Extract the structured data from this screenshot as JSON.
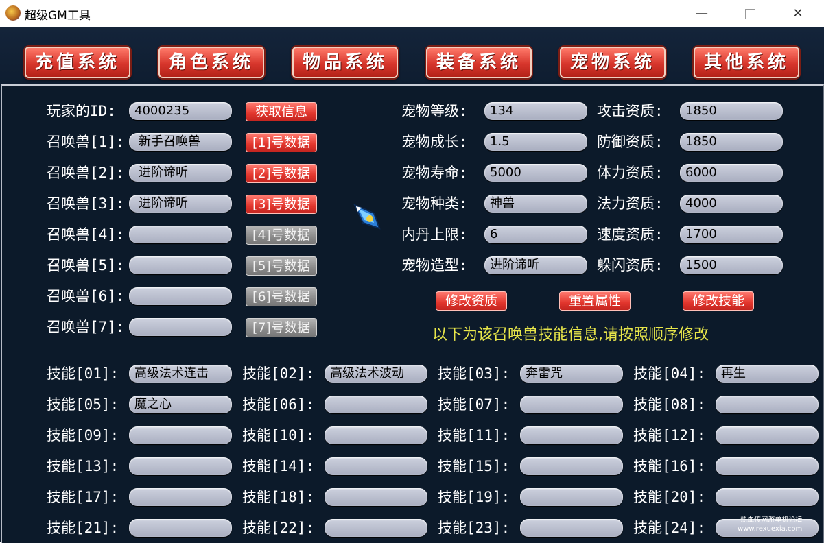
{
  "window": {
    "title": "超级GM工具",
    "minimize": "—",
    "close": "✕"
  },
  "nav": [
    "充值系统",
    "角色系统",
    "物品系统",
    "装备系统",
    "宠物系统",
    "其他系统"
  ],
  "player": {
    "label": "玩家的ID:",
    "value": "4000235",
    "fetch_button": "获取信息"
  },
  "summons": [
    {
      "label": "召唤兽[1]:",
      "value": "新手召唤兽",
      "button": "[1]号数据",
      "enabled": true
    },
    {
      "label": "召唤兽[2]:",
      "value": "进阶谛听",
      "button": "[2]号数据",
      "enabled": true
    },
    {
      "label": "召唤兽[3]:",
      "value": "进阶谛听",
      "button": "[3]号数据",
      "enabled": true
    },
    {
      "label": "召唤兽[4]:",
      "value": "",
      "button": "[4]号数据",
      "enabled": false
    },
    {
      "label": "召唤兽[5]:",
      "value": "",
      "button": "[5]号数据",
      "enabled": false
    },
    {
      "label": "召唤兽[6]:",
      "value": "",
      "button": "[6]号数据",
      "enabled": false
    },
    {
      "label": "召唤兽[7]:",
      "value": "",
      "button": "[7]号数据",
      "enabled": false
    }
  ],
  "pet_stats": [
    {
      "label": "宠物等级:",
      "value": "134"
    },
    {
      "label": "宠物成长:",
      "value": "1.5"
    },
    {
      "label": "宠物寿命:",
      "value": "5000"
    },
    {
      "label": "宠物种类:",
      "value": "神兽"
    },
    {
      "label": "内丹上限:",
      "value": "6"
    },
    {
      "label": "宠物造型:",
      "value": "进阶谛听"
    }
  ],
  "aptitudes": [
    {
      "label": "攻击资质:",
      "value": "1850"
    },
    {
      "label": "防御资质:",
      "value": "1850"
    },
    {
      "label": "体力资质:",
      "value": "6000"
    },
    {
      "label": "法力资质:",
      "value": "4000"
    },
    {
      "label": "速度资质:",
      "value": "1700"
    },
    {
      "label": "躲闪资质:",
      "value": "1500"
    }
  ],
  "actions": [
    "修改资质",
    "重置属性",
    "修改技能"
  ],
  "notice": "以下为该召唤兽技能信息,请按照顺序修改",
  "skills": [
    {
      "label": "技能[01]:",
      "value": "高级法术连击"
    },
    {
      "label": "技能[02]:",
      "value": "高级法术波动"
    },
    {
      "label": "技能[03]:",
      "value": "奔雷咒"
    },
    {
      "label": "技能[04]:",
      "value": "再生"
    },
    {
      "label": "技能[05]:",
      "value": "魔之心"
    },
    {
      "label": "技能[06]:",
      "value": ""
    },
    {
      "label": "技能[07]:",
      "value": ""
    },
    {
      "label": "技能[08]:",
      "value": ""
    },
    {
      "label": "技能[09]:",
      "value": ""
    },
    {
      "label": "技能[10]:",
      "value": ""
    },
    {
      "label": "技能[11]:",
      "value": ""
    },
    {
      "label": "技能[12]:",
      "value": ""
    },
    {
      "label": "技能[13]:",
      "value": ""
    },
    {
      "label": "技能[14]:",
      "value": ""
    },
    {
      "label": "技能[15]:",
      "value": ""
    },
    {
      "label": "技能[16]:",
      "value": ""
    },
    {
      "label": "技能[17]:",
      "value": ""
    },
    {
      "label": "技能[18]:",
      "value": ""
    },
    {
      "label": "技能[19]:",
      "value": ""
    },
    {
      "label": "技能[20]:",
      "value": ""
    },
    {
      "label": "技能[21]:",
      "value": ""
    },
    {
      "label": "技能[22]:",
      "value": ""
    },
    {
      "label": "技能[23]:",
      "value": ""
    },
    {
      "label": "技能[24]:",
      "value": ""
    }
  ],
  "watermark": {
    "line1": "热血传网游单机论坛",
    "line2": "www.rexuexia.com"
  },
  "colors": {
    "accent_red": "#e2362d",
    "disabled_gray": "#8a8a8a",
    "notice_yellow": "#e8e64a",
    "panel_bg": "#0c1a2a"
  }
}
